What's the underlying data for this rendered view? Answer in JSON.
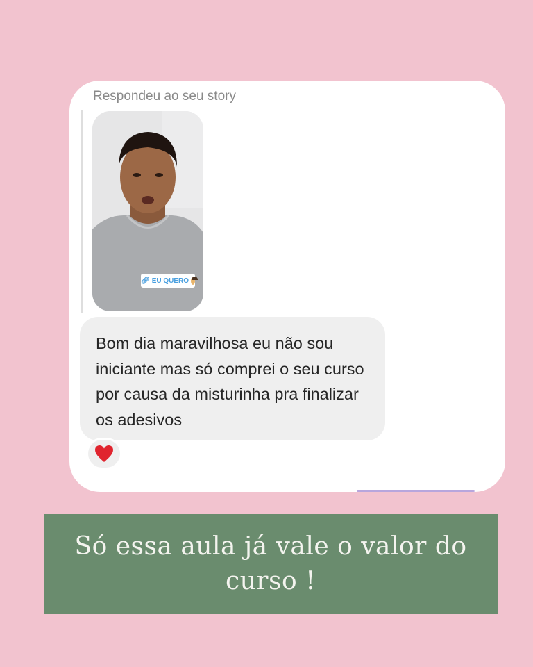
{
  "story_reply": {
    "label": "Respondeu ao seu story",
    "thumbnail_icon": "story-video-thumbnail",
    "sticker": {
      "link_icon": "link-icon",
      "text": "EU QUERO",
      "emoji_icon": "woman-emoji-icon",
      "text_color": "#4aa0e0"
    }
  },
  "message": {
    "text": "Bom dia maravilhosa eu não sou iniciante mas só comprei o seu curso por causa da misturinha pra finalizar os adesivos",
    "bubble_color": "#efefef"
  },
  "reaction": {
    "icon": "red-heart-icon",
    "color": "#e0242e"
  },
  "caption": {
    "text": "Só essa aula já vale o valor do curso !",
    "background": "#6a8c6e"
  },
  "colors": {
    "page_background": "#f2c3cf",
    "card_background": "#ffffff"
  }
}
